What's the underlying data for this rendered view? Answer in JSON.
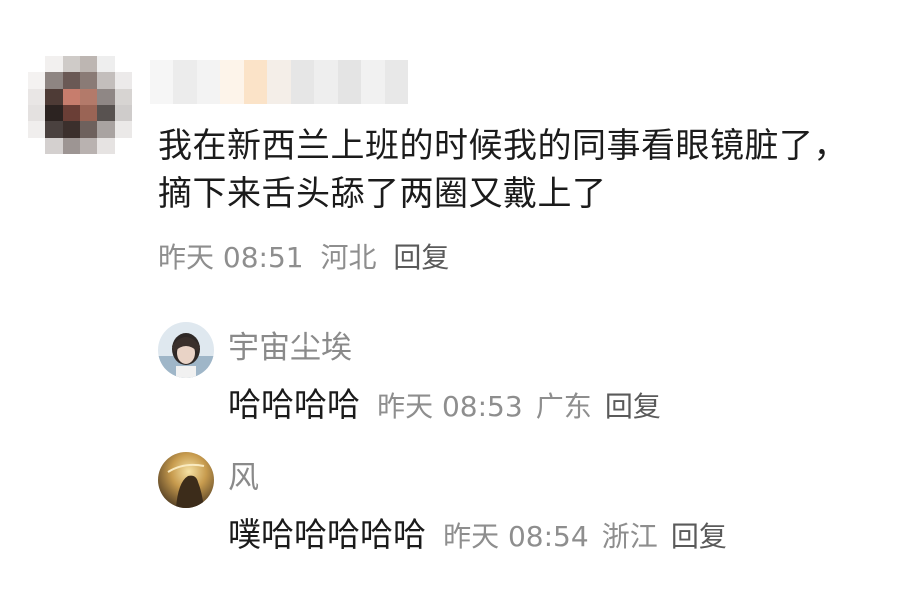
{
  "main_comment": {
    "text": "我在新西兰上班的时候我的同事看眼镜脏了，摘下来舌头舔了两圈又戴上了",
    "time": "昨天 08:51",
    "location": "河北",
    "reply_label": "回复"
  },
  "replies": [
    {
      "username": "宇宙尘埃",
      "text": "哈哈哈哈",
      "time": "昨天 08:53",
      "location": "广东",
      "reply_label": "回复"
    },
    {
      "username": "风",
      "text": "噗哈哈哈哈哈",
      "time": "昨天 08:54",
      "location": "浙江",
      "reply_label": "回复"
    }
  ]
}
